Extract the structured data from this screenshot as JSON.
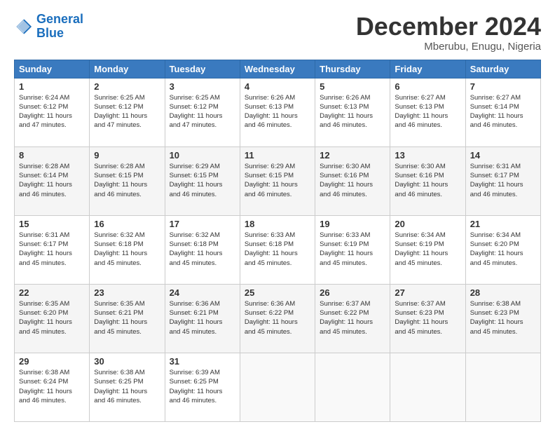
{
  "logo": {
    "line1": "General",
    "line2": "Blue"
  },
  "header": {
    "month": "December 2024",
    "location": "Mberubu, Enugu, Nigeria"
  },
  "days_of_week": [
    "Sunday",
    "Monday",
    "Tuesday",
    "Wednesday",
    "Thursday",
    "Friday",
    "Saturday"
  ],
  "weeks": [
    [
      {
        "num": "1",
        "info": "Sunrise: 6:24 AM\nSunset: 6:12 PM\nDaylight: 11 hours\nand 47 minutes."
      },
      {
        "num": "2",
        "info": "Sunrise: 6:25 AM\nSunset: 6:12 PM\nDaylight: 11 hours\nand 47 minutes."
      },
      {
        "num": "3",
        "info": "Sunrise: 6:25 AM\nSunset: 6:12 PM\nDaylight: 11 hours\nand 47 minutes."
      },
      {
        "num": "4",
        "info": "Sunrise: 6:26 AM\nSunset: 6:13 PM\nDaylight: 11 hours\nand 46 minutes."
      },
      {
        "num": "5",
        "info": "Sunrise: 6:26 AM\nSunset: 6:13 PM\nDaylight: 11 hours\nand 46 minutes."
      },
      {
        "num": "6",
        "info": "Sunrise: 6:27 AM\nSunset: 6:13 PM\nDaylight: 11 hours\nand 46 minutes."
      },
      {
        "num": "7",
        "info": "Sunrise: 6:27 AM\nSunset: 6:14 PM\nDaylight: 11 hours\nand 46 minutes."
      }
    ],
    [
      {
        "num": "8",
        "info": "Sunrise: 6:28 AM\nSunset: 6:14 PM\nDaylight: 11 hours\nand 46 minutes."
      },
      {
        "num": "9",
        "info": "Sunrise: 6:28 AM\nSunset: 6:15 PM\nDaylight: 11 hours\nand 46 minutes."
      },
      {
        "num": "10",
        "info": "Sunrise: 6:29 AM\nSunset: 6:15 PM\nDaylight: 11 hours\nand 46 minutes."
      },
      {
        "num": "11",
        "info": "Sunrise: 6:29 AM\nSunset: 6:15 PM\nDaylight: 11 hours\nand 46 minutes."
      },
      {
        "num": "12",
        "info": "Sunrise: 6:30 AM\nSunset: 6:16 PM\nDaylight: 11 hours\nand 46 minutes."
      },
      {
        "num": "13",
        "info": "Sunrise: 6:30 AM\nSunset: 6:16 PM\nDaylight: 11 hours\nand 46 minutes."
      },
      {
        "num": "14",
        "info": "Sunrise: 6:31 AM\nSunset: 6:17 PM\nDaylight: 11 hours\nand 46 minutes."
      }
    ],
    [
      {
        "num": "15",
        "info": "Sunrise: 6:31 AM\nSunset: 6:17 PM\nDaylight: 11 hours\nand 45 minutes."
      },
      {
        "num": "16",
        "info": "Sunrise: 6:32 AM\nSunset: 6:18 PM\nDaylight: 11 hours\nand 45 minutes."
      },
      {
        "num": "17",
        "info": "Sunrise: 6:32 AM\nSunset: 6:18 PM\nDaylight: 11 hours\nand 45 minutes."
      },
      {
        "num": "18",
        "info": "Sunrise: 6:33 AM\nSunset: 6:18 PM\nDaylight: 11 hours\nand 45 minutes."
      },
      {
        "num": "19",
        "info": "Sunrise: 6:33 AM\nSunset: 6:19 PM\nDaylight: 11 hours\nand 45 minutes."
      },
      {
        "num": "20",
        "info": "Sunrise: 6:34 AM\nSunset: 6:19 PM\nDaylight: 11 hours\nand 45 minutes."
      },
      {
        "num": "21",
        "info": "Sunrise: 6:34 AM\nSunset: 6:20 PM\nDaylight: 11 hours\nand 45 minutes."
      }
    ],
    [
      {
        "num": "22",
        "info": "Sunrise: 6:35 AM\nSunset: 6:20 PM\nDaylight: 11 hours\nand 45 minutes."
      },
      {
        "num": "23",
        "info": "Sunrise: 6:35 AM\nSunset: 6:21 PM\nDaylight: 11 hours\nand 45 minutes."
      },
      {
        "num": "24",
        "info": "Sunrise: 6:36 AM\nSunset: 6:21 PM\nDaylight: 11 hours\nand 45 minutes."
      },
      {
        "num": "25",
        "info": "Sunrise: 6:36 AM\nSunset: 6:22 PM\nDaylight: 11 hours\nand 45 minutes."
      },
      {
        "num": "26",
        "info": "Sunrise: 6:37 AM\nSunset: 6:22 PM\nDaylight: 11 hours\nand 45 minutes."
      },
      {
        "num": "27",
        "info": "Sunrise: 6:37 AM\nSunset: 6:23 PM\nDaylight: 11 hours\nand 45 minutes."
      },
      {
        "num": "28",
        "info": "Sunrise: 6:38 AM\nSunset: 6:23 PM\nDaylight: 11 hours\nand 45 minutes."
      }
    ],
    [
      {
        "num": "29",
        "info": "Sunrise: 6:38 AM\nSunset: 6:24 PM\nDaylight: 11 hours\nand 46 minutes."
      },
      {
        "num": "30",
        "info": "Sunrise: 6:38 AM\nSunset: 6:25 PM\nDaylight: 11 hours\nand 46 minutes."
      },
      {
        "num": "31",
        "info": "Sunrise: 6:39 AM\nSunset: 6:25 PM\nDaylight: 11 hours\nand 46 minutes."
      },
      {
        "num": "",
        "info": ""
      },
      {
        "num": "",
        "info": ""
      },
      {
        "num": "",
        "info": ""
      },
      {
        "num": "",
        "info": ""
      }
    ]
  ]
}
